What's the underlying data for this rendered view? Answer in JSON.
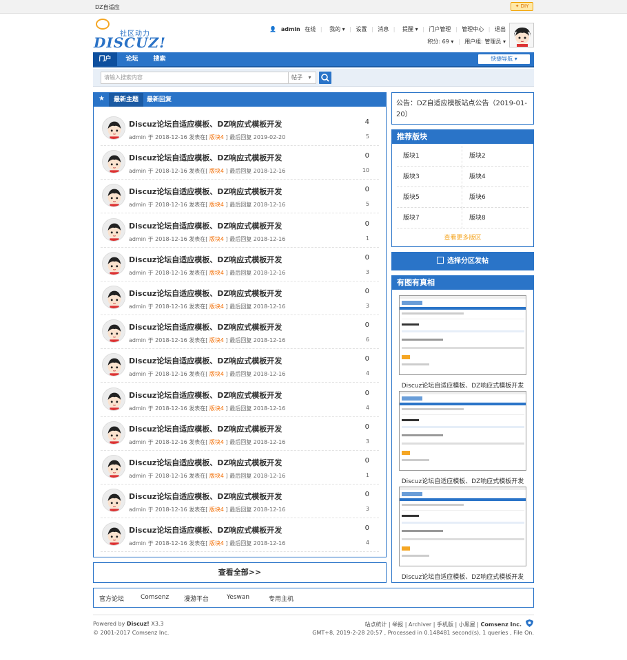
{
  "topbar": {
    "site": "DZ自适应",
    "diy": "DIY"
  },
  "logo": {
    "tag": "社区动力",
    "word": "DISCUZ!"
  },
  "user": {
    "name": "admin",
    "status": "在线",
    "my": "我的",
    "settings": "设置",
    "messages": "消息",
    "remind": "提醒",
    "portal_admin": "门户管理",
    "admin_center": "管理中心",
    "logout": "退出",
    "credits": "积分: 69",
    "group": "用户组: 管理员"
  },
  "nav": {
    "items": [
      "门户",
      "论坛",
      "搜索"
    ],
    "quick": "快捷导航"
  },
  "search": {
    "placeholder": "请输入搜索内容",
    "type": "帖子"
  },
  "tabs": {
    "new_threads": "最新主题",
    "new_replies": "最新回复"
  },
  "threads": [
    {
      "title": "Discuz论坛自适应模板、DZ响应式模板开发",
      "author": "admin",
      "yu": "于",
      "date": "2018-12-16",
      "posted_in": "发表在",
      "forum": "版块4",
      "last": "最后回复 2019-02-20",
      "replies": "4",
      "views": "5"
    },
    {
      "title": "Discuz论坛自适应模板、DZ响应式模板开发",
      "author": "admin",
      "yu": "于",
      "date": "2018-12-16",
      "posted_in": "发表在",
      "forum": "版块4",
      "last": "最后回复 2018-12-16",
      "replies": "0",
      "views": "10"
    },
    {
      "title": "Discuz论坛自适应模板、DZ响应式模板开发",
      "author": "admin",
      "yu": "于",
      "date": "2018-12-16",
      "posted_in": "发表在",
      "forum": "版块4",
      "last": "最后回复 2018-12-16",
      "replies": "0",
      "views": "5"
    },
    {
      "title": "Discuz论坛自适应模板、DZ响应式模板开发",
      "author": "admin",
      "yu": "于",
      "date": "2018-12-16",
      "posted_in": "发表在",
      "forum": "版块4",
      "last": "最后回复 2018-12-16",
      "replies": "0",
      "views": "1"
    },
    {
      "title": "Discuz论坛自适应模板、DZ响应式模板开发",
      "author": "admin",
      "yu": "于",
      "date": "2018-12-16",
      "posted_in": "发表在",
      "forum": "版块4",
      "last": "最后回复 2018-12-16",
      "replies": "0",
      "views": "3"
    },
    {
      "title": "Discuz论坛自适应模板、DZ响应式模板开发",
      "author": "admin",
      "yu": "于",
      "date": "2018-12-16",
      "posted_in": "发表在",
      "forum": "版块4",
      "last": "最后回复 2018-12-16",
      "replies": "0",
      "views": "3"
    },
    {
      "title": "Discuz论坛自适应模板、DZ响应式模板开发",
      "author": "admin",
      "yu": "于",
      "date": "2018-12-16",
      "posted_in": "发表在",
      "forum": "版块4",
      "last": "最后回复 2018-12-16",
      "replies": "0",
      "views": "6"
    },
    {
      "title": "Discuz论坛自适应模板、DZ响应式模板开发",
      "author": "admin",
      "yu": "于",
      "date": "2018-12-16",
      "posted_in": "发表在",
      "forum": "版块4",
      "last": "最后回复 2018-12-16",
      "replies": "0",
      "views": "4"
    },
    {
      "title": "Discuz论坛自适应模板、DZ响应式模板开发",
      "author": "admin",
      "yu": "于",
      "date": "2018-12-16",
      "posted_in": "发表在",
      "forum": "版块4",
      "last": "最后回复 2018-12-16",
      "replies": "0",
      "views": "4"
    },
    {
      "title": "Discuz论坛自适应模板、DZ响应式模板开发",
      "author": "admin",
      "yu": "于",
      "date": "2018-12-16",
      "posted_in": "发表在",
      "forum": "版块4",
      "last": "最后回复 2018-12-16",
      "replies": "0",
      "views": "3"
    },
    {
      "title": "Discuz论坛自适应模板、DZ响应式模板开发",
      "author": "admin",
      "yu": "于",
      "date": "2018-12-16",
      "posted_in": "发表在",
      "forum": "版块4",
      "last": "最后回复 2018-12-16",
      "replies": "0",
      "views": "1"
    },
    {
      "title": "Discuz论坛自适应模板、DZ响应式模板开发",
      "author": "admin",
      "yu": "于",
      "date": "2018-12-16",
      "posted_in": "发表在",
      "forum": "版块4",
      "last": "最后回复 2018-12-16",
      "replies": "0",
      "views": "3"
    },
    {
      "title": "Discuz论坛自适应模板、DZ响应式模板开发",
      "author": "admin",
      "yu": "于",
      "date": "2018-12-16",
      "posted_in": "发表在",
      "forum": "版块4",
      "last": "最后回复 2018-12-16",
      "replies": "0",
      "views": "4"
    }
  ],
  "view_all": "查看全部>>",
  "notice": "公告：DZ自适应模板站点公告（2019-01-20）",
  "forums": {
    "title": "推荐版块",
    "items": [
      "版块1",
      "版块2",
      "版块3",
      "版块4",
      "版块5",
      "版块6",
      "版块7",
      "版块8"
    ],
    "more": "查看更多版区"
  },
  "post_button": "选择分区发帖",
  "pics": {
    "title": "有图有真相",
    "captions": [
      "Discuz论坛自适应模板、DZ响应式模板开发",
      "Discuz论坛自适应模板、DZ响应式模板开发",
      "Discuz论坛自适应模板、DZ响应式模板开发"
    ]
  },
  "links": [
    "官方论坛",
    "Comsenz",
    "漫游平台",
    "Yeswan",
    "专用主机"
  ],
  "footer": {
    "powered_prefix": "Powered by",
    "brand": "Discuz!",
    "version": "X3.3",
    "copyright": "© 2001-2017 Comsenz Inc.",
    "right_links": "站点统计 | 举报 | Archiver | 手机版 | 小黑屋 |",
    "company": "Comsenz Inc.",
    "stats": "GMT+8, 2019-2-28 20:57 , Processed in 0.148481 second(s), 1 queries , File On."
  },
  "colors": {
    "primary": "#2a74c8",
    "accent": "#f5a623",
    "link_orange": "#f26c00"
  }
}
